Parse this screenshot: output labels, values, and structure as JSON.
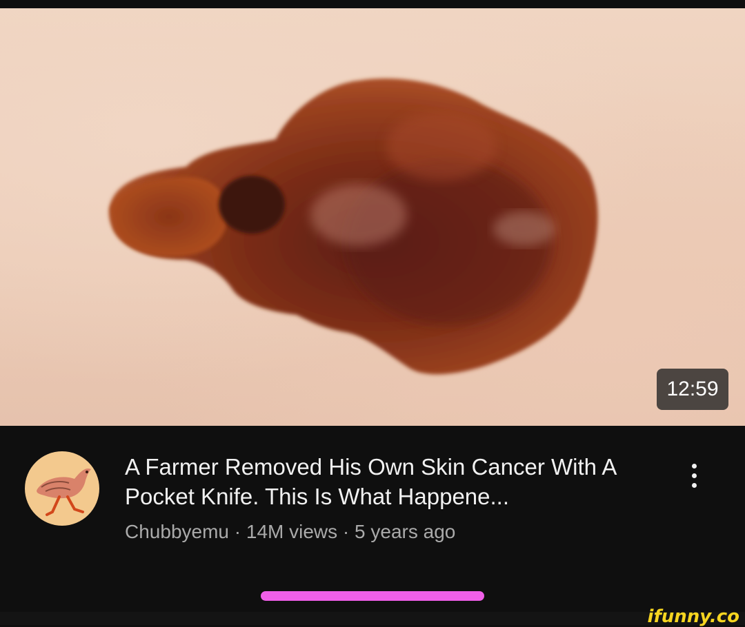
{
  "video": {
    "duration": "12:59",
    "title": "A Farmer Removed His Own Skin Cancer With A Pocket Knife. This Is What Happene...",
    "channel": "Chubbyemu",
    "views": "14M views",
    "age": "5 years ago",
    "separator": " · "
  },
  "icons": {
    "more": "more-vertical-icon"
  },
  "watermark": "ifunny.co",
  "colors": {
    "background": "#0f0f0f",
    "title": "#f1f1f1",
    "meta": "#aaaaaa",
    "gesture_bar": "#f05fe8",
    "watermark": "#f7d520",
    "avatar_bg": "#f3c98e"
  }
}
